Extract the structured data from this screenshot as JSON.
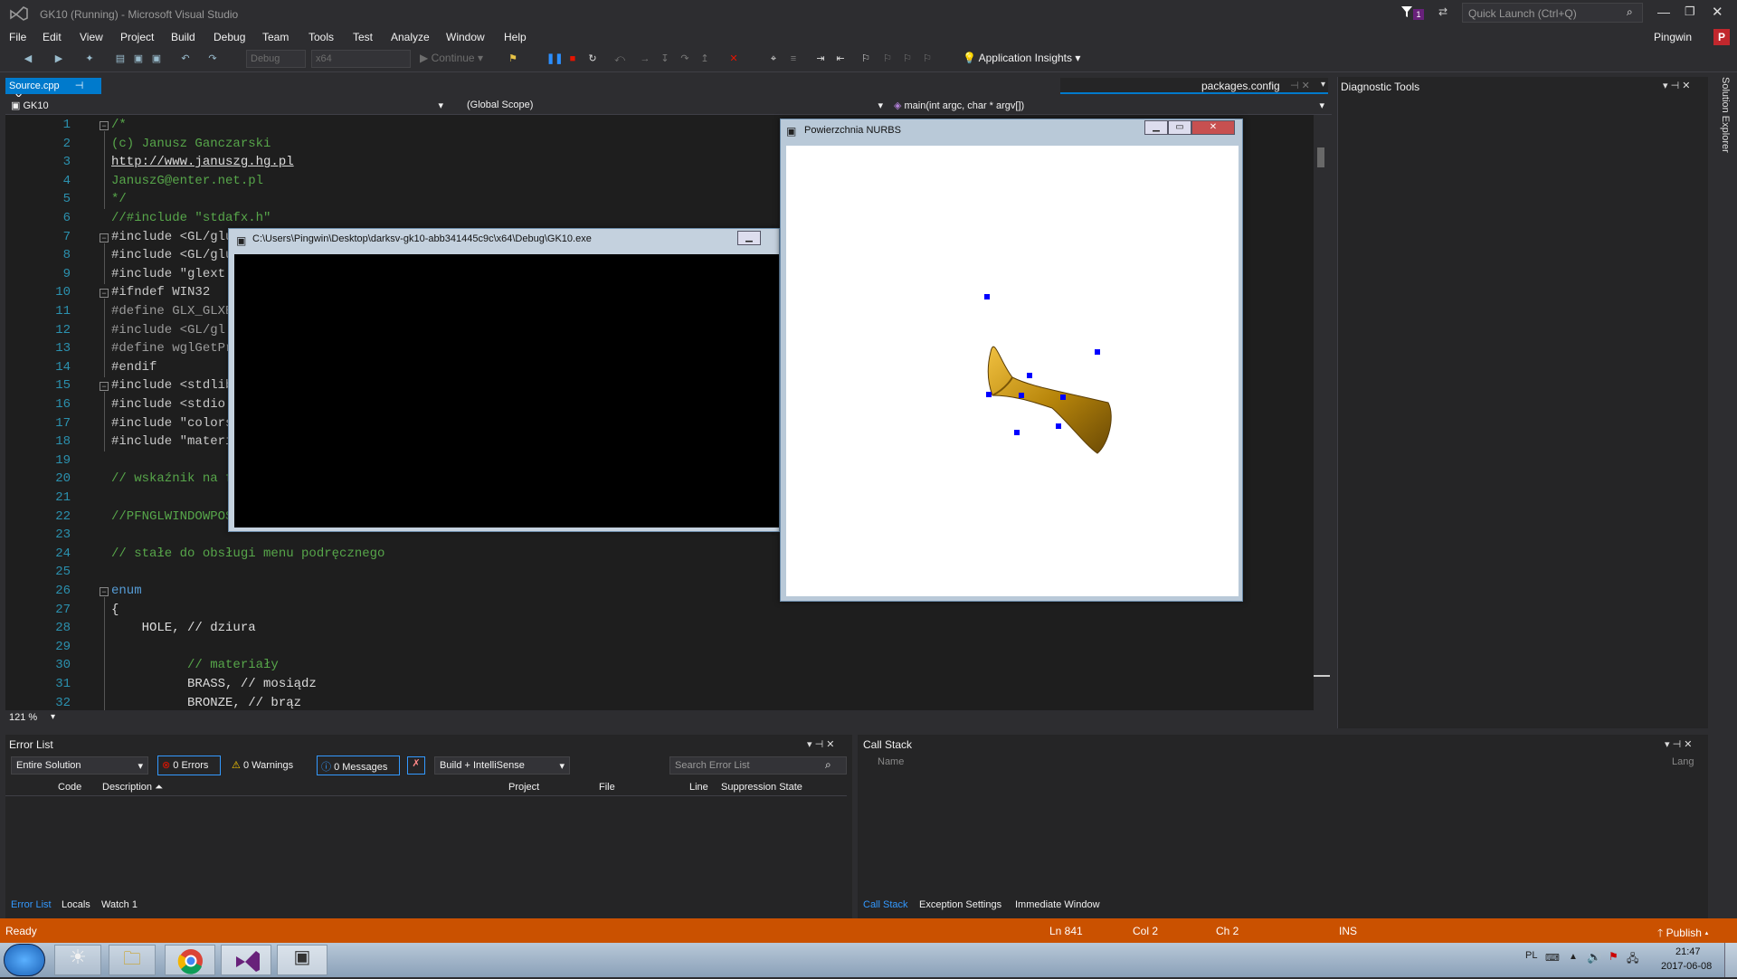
{
  "title_bar": {
    "title": "GK10 (Running) - Microsoft Visual Studio",
    "notification_count": "1",
    "quick_launch_placeholder": "Quick Launch (Ctrl+Q)",
    "user": "Pingwin",
    "user_initial": "P"
  },
  "menu": [
    "File",
    "Edit",
    "View",
    "Project",
    "Build",
    "Debug",
    "Team",
    "Tools",
    "Test",
    "Analyze",
    "Window",
    "Help"
  ],
  "toolbar": {
    "config": "Debug",
    "platform": "x64",
    "continue_label": "Continue",
    "app_insights": "Application Insights"
  },
  "tabs": {
    "active": "Source.cpp",
    "secondary": "packages.config"
  },
  "navbar": {
    "project": "GK10",
    "scope": "(Global Scope)",
    "function": "main(int argc, char * argv[])"
  },
  "editor": {
    "zoom": "121 %",
    "lines": [
      {
        "n": "1",
        "t": "/*"
      },
      {
        "n": "2",
        "t": "(c) Janusz Ganczarski"
      },
      {
        "n": "3",
        "t": "http://www.januszg.hg.pl"
      },
      {
        "n": "4",
        "t": "JanuszG@enter.net.pl"
      },
      {
        "n": "5",
        "t": "*/"
      },
      {
        "n": "6",
        "t": "//#include \"stdafx.h\""
      },
      {
        "n": "7",
        "t": "#include <GL/glu"
      },
      {
        "n": "8",
        "t": "#include <GL/glu"
      },
      {
        "n": "9",
        "t": "#include \"glext"
      },
      {
        "n": "10",
        "t": "#ifndef WIN32"
      },
      {
        "n": "11",
        "t": "#define GLX_GLXE"
      },
      {
        "n": "12",
        "t": "#include <GL/gl"
      },
      {
        "n": "13",
        "t": "#define wglGetPr"
      },
      {
        "n": "14",
        "t": "#endif"
      },
      {
        "n": "15",
        "t": "#include <stdlib"
      },
      {
        "n": "16",
        "t": "#include <stdio"
      },
      {
        "n": "17",
        "t": "#include \"colors"
      },
      {
        "n": "18",
        "t": "#include \"materi"
      },
      {
        "n": "19",
        "t": ""
      },
      {
        "n": "20",
        "t": "// wskaźnik na f"
      },
      {
        "n": "21",
        "t": ""
      },
      {
        "n": "22",
        "t": "//PFNGLWINDOWPOS"
      },
      {
        "n": "23",
        "t": ""
      },
      {
        "n": "24",
        "t": "// stałe do obsługi menu podręcznego"
      },
      {
        "n": "25",
        "t": ""
      },
      {
        "n": "26",
        "t": "enum"
      },
      {
        "n": "27",
        "t": "{"
      },
      {
        "n": "28",
        "t": "    HOLE, // dziura"
      },
      {
        "n": "29",
        "t": ""
      },
      {
        "n": "30",
        "t": "          // materiały"
      },
      {
        "n": "31",
        "t": "          BRASS, // mosiądz"
      },
      {
        "n": "32",
        "t": "          BRONZE, // brąz"
      }
    ]
  },
  "console_window": {
    "title": "C:\\Users\\Pingwin\\Desktop\\darksv-gk10-abb341445c9c\\x64\\Debug\\GK10.exe"
  },
  "nurbs_window": {
    "title": "Powierzchnia NURBS"
  },
  "diagnostic_tools": {
    "title": "Diagnostic Tools"
  },
  "solution_explorer": "Solution Explorer",
  "error_list": {
    "title": "Error List",
    "scope": "Entire Solution",
    "errors": "0 Errors",
    "warnings": "0 Warnings",
    "messages": "0 Messages",
    "build_filter": "Build + IntelliSense",
    "search_placeholder": "Search Error List",
    "columns": [
      "Code",
      "Description",
      "Project",
      "File",
      "Line",
      "Suppression State"
    ],
    "tabs": [
      "Error List",
      "Locals",
      "Watch 1"
    ]
  },
  "call_stack": {
    "title": "Call Stack",
    "col_name": "Name",
    "col_lang": "Lang",
    "tabs": [
      "Call Stack",
      "Exception Settings",
      "Immediate Window"
    ]
  },
  "status": {
    "ready": "Ready",
    "ln": "Ln 841",
    "col": "Col 2",
    "ch": "Ch 2",
    "ins": "INS",
    "publish": "Publish"
  },
  "taskbar": {
    "lang": "PL",
    "time": "21:47",
    "date": "2017-06-08"
  },
  "colors": {
    "accent": "#007acc",
    "status": "#ca5100",
    "comment": "#57a64a",
    "keyword": "#569cd6",
    "string": "#d69d85",
    "preproc": "#9b9b9b"
  }
}
